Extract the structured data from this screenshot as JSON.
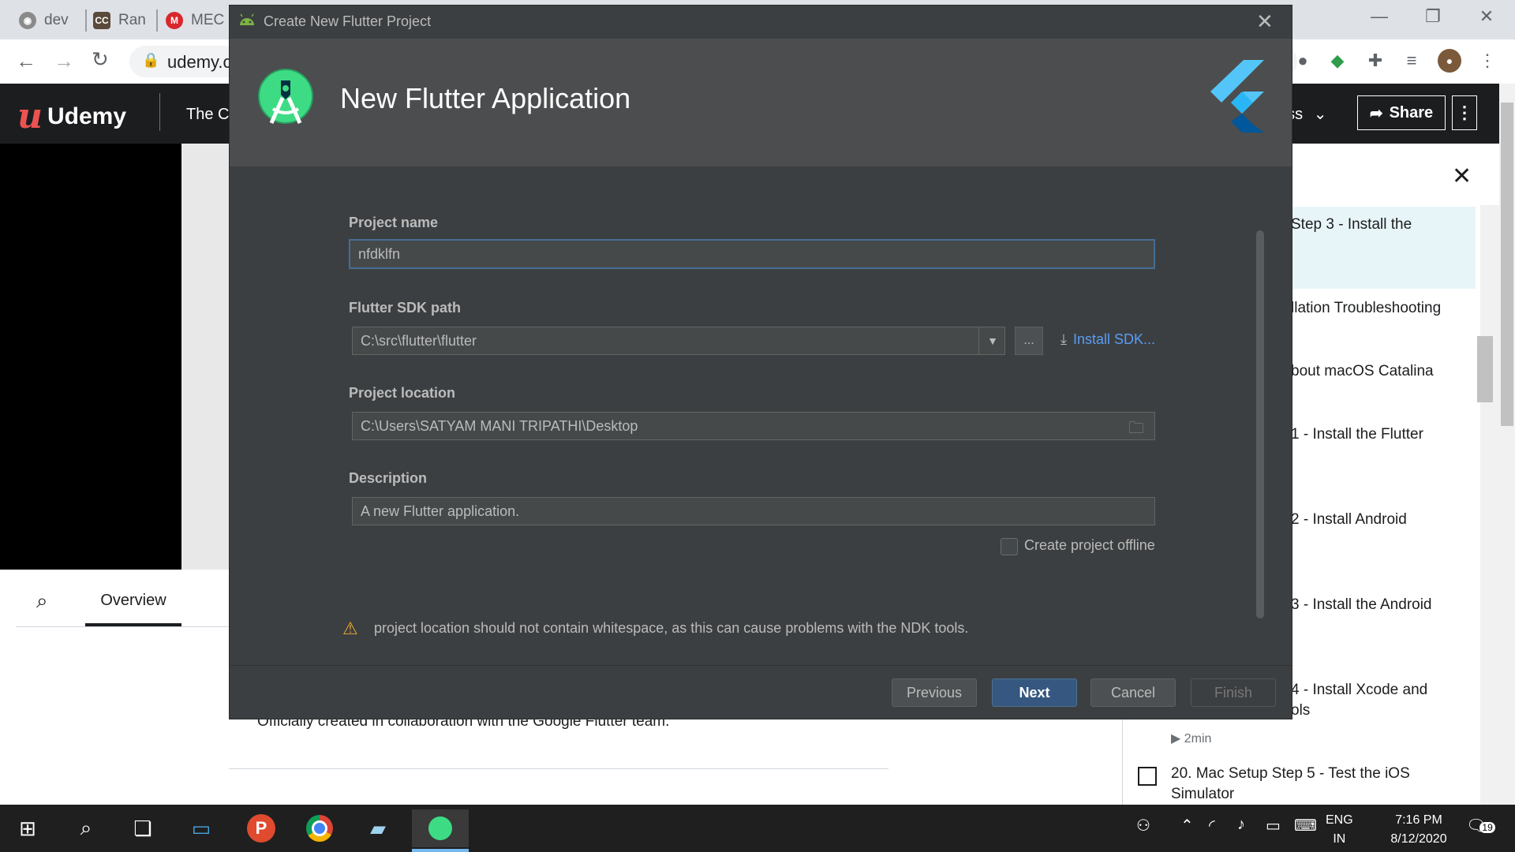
{
  "browser": {
    "tabs": [
      {
        "label": "dev",
        "icon": "globe-icon"
      },
      {
        "label": "Ran",
        "icon": "cc-icon"
      },
      {
        "label": "MEC",
        "icon": "mega-icon"
      }
    ],
    "url": "udemy.c"
  },
  "udemy": {
    "logo_text": "Udemy",
    "course_title_partial": "The Co",
    "progress_partial": "ess",
    "share_label": "Share",
    "overview_tab": "Overview",
    "description_line": "Officially created in collaboration with the Google Flutter team.",
    "lectures": [
      "Step 3 - Install the",
      "llation Troubleshooting",
      "bout macOS Catalina",
      "1 - Install the Flutter",
      "2 - Install Android",
      "3 - Install the Android",
      "4 - Install Xcode and",
      "ols"
    ],
    "duration": "2min",
    "lecture_20": "20. Mac Setup Step 5 - Test the iOS",
    "lecture_20_line2": "Simulator"
  },
  "dialog": {
    "window_title": "Create New Flutter Project",
    "header_title": "New Flutter Application",
    "project_name_label": "Project name",
    "project_name_value": "nfdklfn",
    "sdk_path_label": "Flutter SDK path",
    "sdk_path_value": "C:\\src\\flutter\\flutter",
    "browse_label": "...",
    "install_sdk_label": "Install SDK...",
    "location_label": "Project location",
    "location_value": "C:\\Users\\SATYAM MANI TRIPATHI\\Desktop",
    "description_label": "Description",
    "description_value": "A new Flutter application.",
    "offline_label": "Create project offline",
    "offline_checked": false,
    "warning": "project location should not contain whitespace, as this can cause problems with the NDK tools.",
    "buttons": {
      "previous": "Previous",
      "next": "Next",
      "cancel": "Cancel",
      "finish": "Finish"
    }
  },
  "taskbar": {
    "language": "ENG",
    "region": "IN",
    "time": "7:16 PM",
    "date": "8/12/2020",
    "notifications": "19"
  },
  "colors": {
    "accent_blue": "#365880",
    "link_blue": "#589df6",
    "dialog_bg": "#3c3f41",
    "udemy_red": "#ec5252"
  }
}
